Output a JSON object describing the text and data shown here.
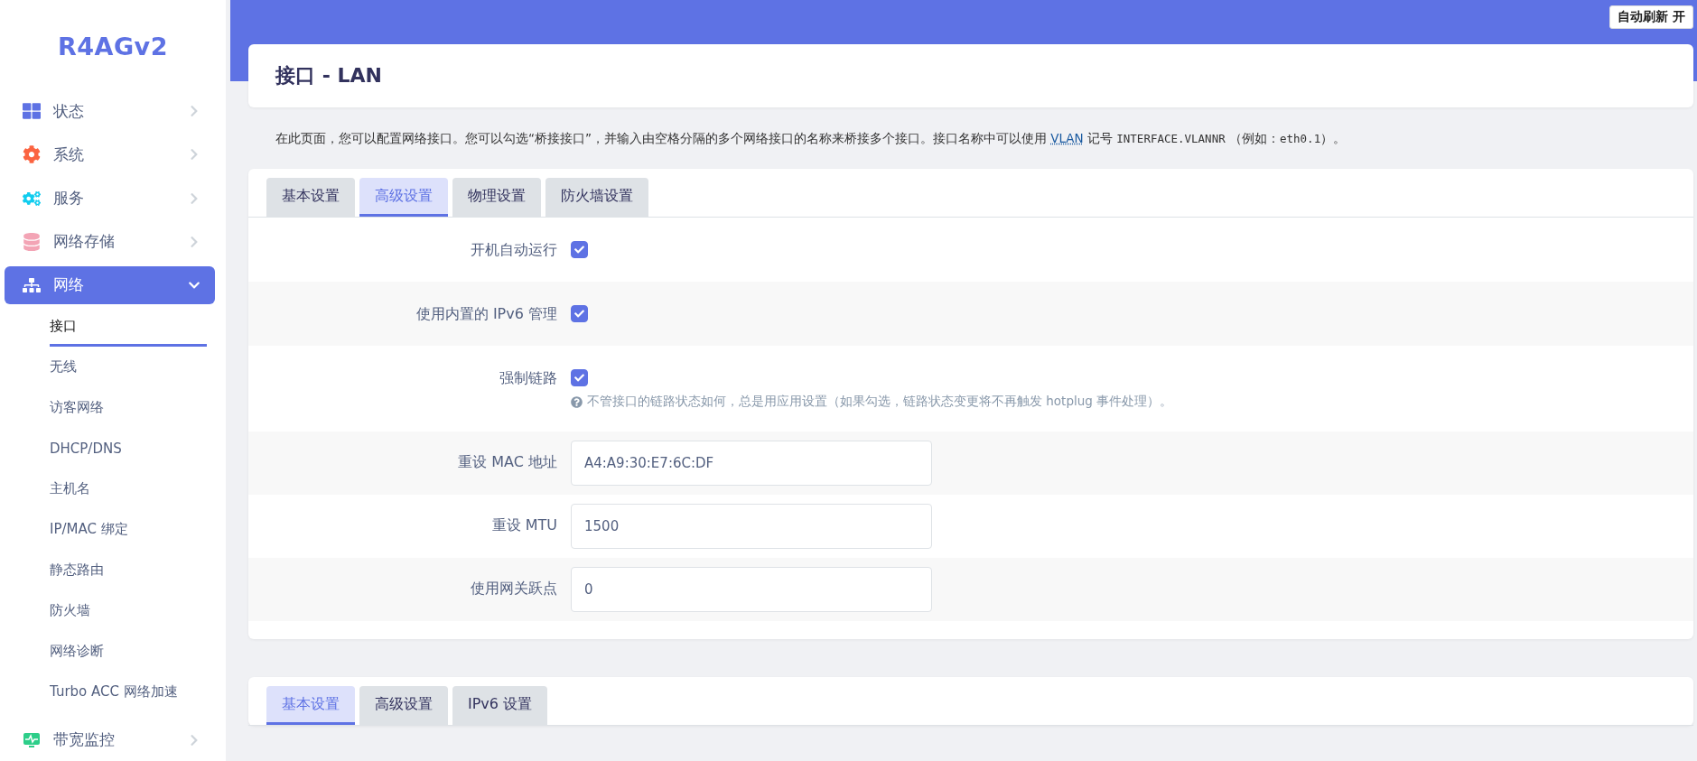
{
  "logo": "R4AGv2",
  "sidebar": {
    "items": [
      {
        "label": "状态",
        "selected": false,
        "expanded": false
      },
      {
        "label": "系统",
        "selected": false,
        "expanded": false
      },
      {
        "label": "服务",
        "selected": false,
        "expanded": false
      },
      {
        "label": "网络存储",
        "selected": false,
        "expanded": false
      },
      {
        "label": "网络",
        "selected": true,
        "expanded": true,
        "children": [
          {
            "label": "接口",
            "selected": true
          },
          {
            "label": "无线",
            "selected": false
          },
          {
            "label": "访客网络",
            "selected": false
          },
          {
            "label": "DHCP/DNS",
            "selected": false
          },
          {
            "label": "主机名",
            "selected": false
          },
          {
            "label": "IP/MAC 绑定",
            "selected": false
          },
          {
            "label": "静态路由",
            "selected": false
          },
          {
            "label": "防火墙",
            "selected": false
          },
          {
            "label": "网络诊断",
            "selected": false
          },
          {
            "label": "Turbo ACC 网络加速",
            "selected": false
          }
        ]
      },
      {
        "label": "带宽监控",
        "selected": false,
        "expanded": false
      }
    ]
  },
  "auto_refresh_button": "自动刷新 开",
  "page_title": "接口 - LAN",
  "description": [
    {
      "kind": "text",
      "text": "在此页面，您可以配置网络接口。您可以勾选“桥接接口”，并输入由空格分隔的多个网络接口的名称来桥接多个接口。接口名称中可以使用 "
    },
    {
      "kind": "abbr",
      "text": "VLAN"
    },
    {
      "kind": "text",
      "text": " 记号 "
    },
    {
      "kind": "code",
      "text": "INTERFACE.VLANNR"
    },
    {
      "kind": "text",
      "text": " （例如："
    },
    {
      "kind": "code",
      "text": "eth0.1"
    },
    {
      "kind": "text",
      "text": "）。"
    }
  ],
  "sections": [
    {
      "tabs": [
        {
          "label": "基本设置",
          "selected": false
        },
        {
          "label": "高级设置",
          "selected": true
        },
        {
          "label": "物理设置",
          "selected": false
        },
        {
          "label": "防火墙设置",
          "selected": false
        }
      ],
      "fields": [
        {
          "kind": "checkbox",
          "label": "开机自动运行",
          "checked": true
        },
        {
          "kind": "checkbox",
          "label": "使用内置的 IPv6 管理",
          "checked": true
        },
        {
          "kind": "checkbox",
          "label": "强制链路",
          "checked": true,
          "hint": "不管接口的链路状态如何，总是用应用设置（如果勾选，链路状态变更将不再触发 hotplug 事件处理）。"
        },
        {
          "kind": "text",
          "label": "重设 MAC 地址",
          "value": "A4:A9:30:E7:6C:DF"
        },
        {
          "kind": "text",
          "label": "重设 MTU",
          "value": "1500"
        },
        {
          "kind": "text",
          "label": "使用网关跃点",
          "value": "0"
        }
      ]
    },
    {
      "tabs": [
        {
          "label": "基本设置",
          "selected": true
        },
        {
          "label": "高级设置",
          "selected": false
        },
        {
          "label": "IPv6 设置",
          "selected": false
        }
      ]
    }
  ]
}
